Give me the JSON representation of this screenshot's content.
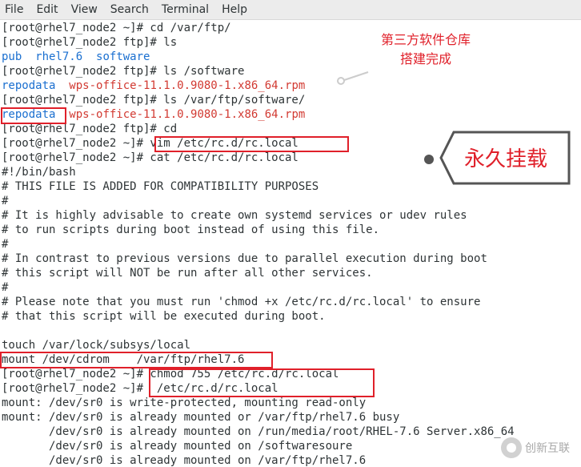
{
  "menu": [
    "File",
    "Edit",
    "View",
    "Search",
    "Terminal",
    "Help"
  ],
  "lines": [
    [
      {
        "t": "[root@rhel7_node2 ~]# cd /var/ftp/"
      }
    ],
    [
      {
        "t": "[root@rhel7_node2 ftp]# ls"
      }
    ],
    [
      {
        "t": "pub",
        "c": "blue"
      },
      {
        "t": "  "
      },
      {
        "t": "rhel7.6",
        "c": "blue"
      },
      {
        "t": "  "
      },
      {
        "t": "software",
        "c": "blue"
      }
    ],
    [
      {
        "t": "[root@rhel7_node2 ftp]# ls /software"
      }
    ],
    [
      {
        "t": "repodata",
        "c": "blue"
      },
      {
        "t": "  "
      },
      {
        "t": "wps-office-11.1.0.9080-1.x86_64.rpm",
        "c": "red"
      }
    ],
    [
      {
        "t": "[root@rhel7_node2 ftp]# ls /var/ftp/software/"
      }
    ],
    [
      {
        "t": "repodata",
        "c": "blue"
      },
      {
        "t": "  "
      },
      {
        "t": "wps-office-11.1.0.9080-1.x86_64.rpm",
        "c": "red"
      }
    ],
    [
      {
        "t": "[root@rhel7_node2 ftp]# cd"
      }
    ],
    [
      {
        "t": "[root@rhel7_node2 ~]# vim /etc/rc.d/rc.local"
      }
    ],
    [
      {
        "t": "[root@rhel7_node2 ~]# cat /etc/rc.d/rc.local"
      }
    ],
    [
      {
        "t": "#!/bin/bash"
      }
    ],
    [
      {
        "t": "# THIS FILE IS ADDED FOR COMPATIBILITY PURPOSES"
      }
    ],
    [
      {
        "t": "#"
      }
    ],
    [
      {
        "t": "# It is highly advisable to create own systemd services or udev rules"
      }
    ],
    [
      {
        "t": "# to run scripts during boot instead of using this file."
      }
    ],
    [
      {
        "t": "#"
      }
    ],
    [
      {
        "t": "# In contrast to previous versions due to parallel execution during boot"
      }
    ],
    [
      {
        "t": "# this script will NOT be run after all other services."
      }
    ],
    [
      {
        "t": "#"
      }
    ],
    [
      {
        "t": "# Please note that you must run 'chmod +x /etc/rc.d/rc.local' to ensure"
      }
    ],
    [
      {
        "t": "# that this script will be executed during boot."
      }
    ],
    [
      {
        "t": ""
      }
    ],
    [
      {
        "t": "touch /var/lock/subsys/local"
      }
    ],
    [
      {
        "t": "mount /dev/cdrom    /var/ftp/rhel7.6"
      }
    ],
    [
      {
        "t": "[root@rhel7_node2 ~]# chmod 755 /etc/rc.d/rc.local"
      }
    ],
    [
      {
        "t": "[root@rhel7_node2 ~]#  /etc/rc.d/rc.local"
      }
    ],
    [
      {
        "t": "mount: /dev/sr0 is write-protected, mounting read-only"
      }
    ],
    [
      {
        "t": "mount: /dev/sr0 is already mounted or /var/ftp/rhel7.6 busy"
      }
    ],
    [
      {
        "t": "       /dev/sr0 is already mounted on /run/media/root/RHEL-7.6 Server.x86_64"
      }
    ],
    [
      {
        "t": "       /dev/sr0 is already mounted on /softwaresoure"
      }
    ],
    [
      {
        "t": "       /dev/sr0 is already mounted on /var/ftp/rhel7.6"
      }
    ]
  ],
  "annotations": {
    "note_top": "第三方软件仓库搭建完成",
    "callout": "永久挂载",
    "accent_color": "#e0202a"
  },
  "watermark": "创新互联"
}
